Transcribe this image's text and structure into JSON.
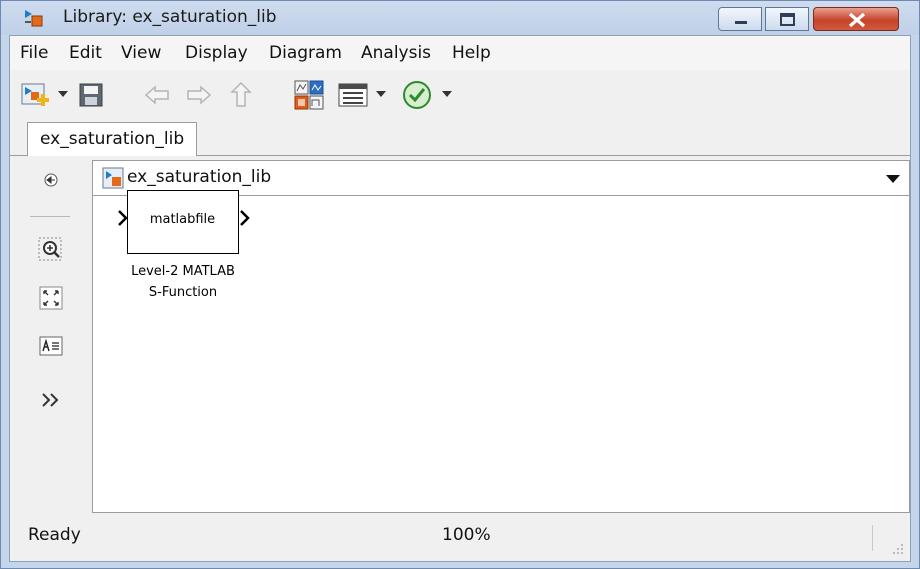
{
  "window": {
    "title": "Library: ex_saturation_lib",
    "icon": "simulink-library-icon",
    "controls": [
      "minimize-icon",
      "maximize-icon",
      "close-icon"
    ],
    "close_color": "#c6442b"
  },
  "menubar": {
    "items": [
      "File",
      "Edit",
      "View",
      "Display",
      "Diagram",
      "Analysis",
      "Help"
    ]
  },
  "toolbar": {
    "icons": [
      "new-model-icon",
      "dropdown-arrow-icon",
      "save-icon",
      "back-icon",
      "forward-icon",
      "up-icon",
      "library-browser-icon",
      "model-explorer-icon",
      "dropdown-arrow-icon",
      "check-icon",
      "dropdown-arrow-icon"
    ]
  },
  "tabs": [
    {
      "label": "ex_saturation_lib",
      "active": true
    }
  ],
  "sidebar": {
    "icons": [
      "hide-browser-icon",
      "zoom-in-icon",
      "fit-to-view-icon",
      "annotation-icon",
      "more-icon"
    ]
  },
  "address": {
    "path": "ex_saturation_lib"
  },
  "canvas": {
    "block": {
      "text": "matlabfile",
      "label_line1": "Level-2 MATLAB",
      "label_line2": "S-Function"
    }
  },
  "status": {
    "state": "Ready",
    "zoom": "100%"
  }
}
